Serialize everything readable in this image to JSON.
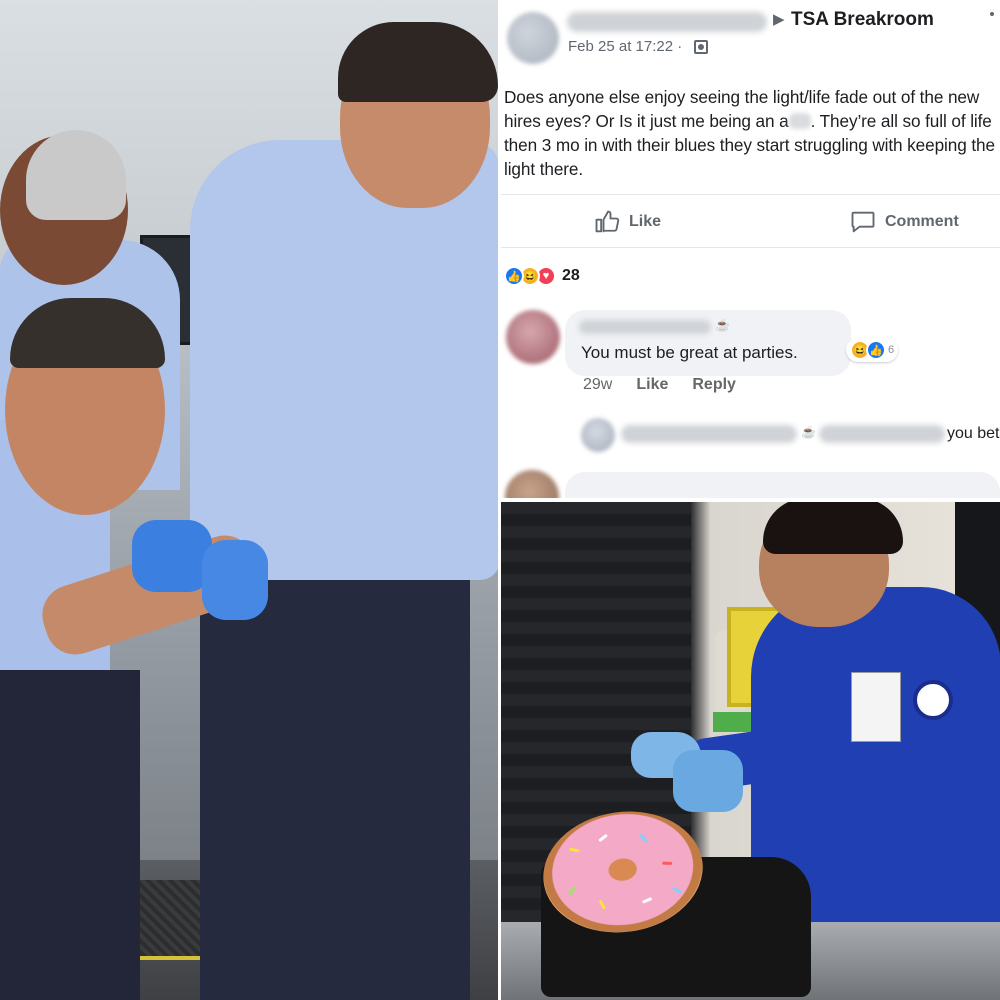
{
  "post": {
    "group_name": "TSA Breakroom",
    "timestamp": "Feb 25 at 17:22 ·",
    "text_part1": "Does anyone else enjoy seeing the light/life fade out of the new hires eyes? Or Is it just me being an a",
    "text_part2": ". They’re all so full of life then 3 mo in with their blues they start struggling with keeping the light there.",
    "like_label": "Like",
    "comment_label": "Comment",
    "reaction_count": "28"
  },
  "comments": [
    {
      "text": "You must be great at parties.",
      "reaction_count": "6",
      "age": "29w",
      "like_label": "Like",
      "reply_label": "Reply"
    }
  ],
  "reply": {
    "text_visible": "you bet"
  },
  "colors": {
    "facebook_blue": "#1877f2",
    "haha_yellow": "#f7b125",
    "love_red": "#f33e58",
    "tsa_uniform_blue": "#1f3fb3"
  }
}
